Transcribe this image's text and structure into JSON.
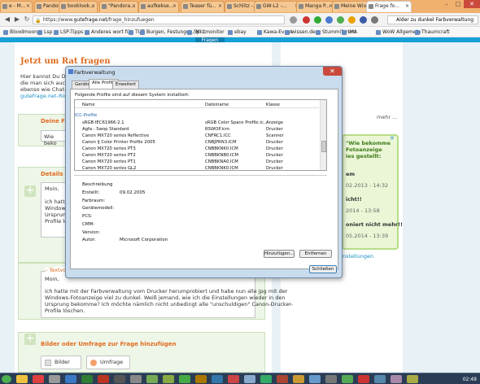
{
  "tabs": [
    {
      "label": "e - M..."
    },
    {
      "label": "Pandora..."
    },
    {
      "label": "booklook..."
    },
    {
      "label": "\"Pandora..."
    },
    {
      "label": "aufkekse..."
    },
    {
      "label": "Teaser fü..."
    },
    {
      "label": "Schlitz -..."
    },
    {
      "label": "GW-L2 -..."
    },
    {
      "label": "Manga P..."
    },
    {
      "label": "Meine Wi..."
    },
    {
      "label": "Frage fo..."
    }
  ],
  "address": {
    "prefix": "https://www.",
    "host": "gutefrage.net",
    "path": "/frage_hinzufuegen"
  },
  "search": {
    "value": "Alder zu dunkel Farbverwaltung"
  },
  "bookmarks": [
    "Bloodmoon",
    "Lsp",
    "LSP-Tipps",
    "Anderes wort für",
    "TUT",
    "Burgen, Festungen, Mi...",
    "Spritmonitor",
    "ebay",
    "Kawa-Event",
    "wissen.de",
    "Stummiforum",
    "IMA",
    "WoW Allgemein",
    "Thaumcraft"
  ],
  "page": {
    "nav": "Fragen",
    "heading": "Jetzt um Rat fragen",
    "intro": [
      "Hier kannst Du De",
      "die man sich auch",
      "ebenso wie Chat-"
    ],
    "intro_link": "gutefrage.net-Rich",
    "q_label": "Deine Fra",
    "q_value": "Wie beko",
    "details_label": "Details zu",
    "details_lines": [
      "Moin,",
      "ich hatte",
      "Windows-",
      "Ursprung",
      "Profile lösc"
    ],
    "textarea_label": "- Textvorsc",
    "textarea_text": [
      "Moin,",
      "ich hatte mit der Farbverwaltung vom Drucker herumprobiert und habe nun alle jpg mit der",
      "Windows-Fotoanzeige viel zu dunkel. Weiß jemand, wie ich die Einstellungen wieder in den",
      "Ursprung bekomme? Ich möchte nämlich nicht unbedingt alle \"unschuldigen\" Canon-Drucker-",
      "Profile löschen."
    ],
    "images_heading": "Bilder oder Umfrage zur Frage hinzufügen",
    "btn_bilder": "Bilder",
    "btn_umfrage": "Umfrage",
    "mehr": "mehr ...",
    "popup_lines": [
      "\"Wie bekomme",
      "Fotoanzeige",
      "ies gestellt:"
    ],
    "popup_sub": "em",
    "popup_date1": "02.2013 - 14:32",
    "popup_mid": "icht!!",
    "popup_date2": "2014 - 13:58",
    "popup_mid2": "oniert nicht mehr!!",
    "popup_date3": "05.2014 - 13:39",
    "right_link": "nstellungen"
  },
  "dialog": {
    "title": "Farbverwaltung",
    "tabs": [
      "Geräte",
      "Alle Profile",
      "Erweitert"
    ],
    "caption": "Folgende Profile sind auf diesem System installiert:",
    "columns": [
      "Name",
      "Dateiname",
      "Klasse"
    ],
    "group": "ICC-Profile",
    "rows": [
      [
        "sRGB IEC61966-2.1",
        "sRGB Color Space Profile.ic...",
        "Anzeige"
      ],
      [
        "Agfa : Swop Standard",
        "RSWOP.icm",
        "Drucker"
      ],
      [
        "Canon MX720 series Reflective",
        "CNFRC1.ICC",
        "Scanner"
      ],
      [
        "Canon IJ Color Printer Profile 2005",
        "CNBJPRN3.ICM",
        "Drucker"
      ],
      [
        "Canon MX720 series PT3",
        "CNBBKNK0.ICM",
        "Drucker"
      ],
      [
        "Canon MX720 series PT2",
        "CNBBKNB0.ICM",
        "Drucker"
      ],
      [
        "Canon MX720 series PT1",
        "CNBBKNA0.ICM",
        "Drucker"
      ],
      [
        "Canon MX720 series GL2",
        "CNBBKNK0.ICM",
        "Drucker"
      ]
    ],
    "desc_title": "Beschreibung",
    "fields": [
      {
        "label": "Erstellt:",
        "value": "09.02.2005"
      },
      {
        "label": "Farbraum:",
        "value": ""
      },
      {
        "label": "Gerätemodell:",
        "value": ""
      },
      {
        "label": "PCS:",
        "value": ""
      },
      {
        "label": "CMM:",
        "value": ""
      },
      {
        "label": "Version:",
        "value": ""
      },
      {
        "label": "Autor:",
        "value": "Microsoft Corporation"
      }
    ],
    "btn_add": "Hinzufügen...",
    "btn_remove": "Entfernen",
    "btn_close": "Schließen"
  },
  "clock": "02:49"
}
